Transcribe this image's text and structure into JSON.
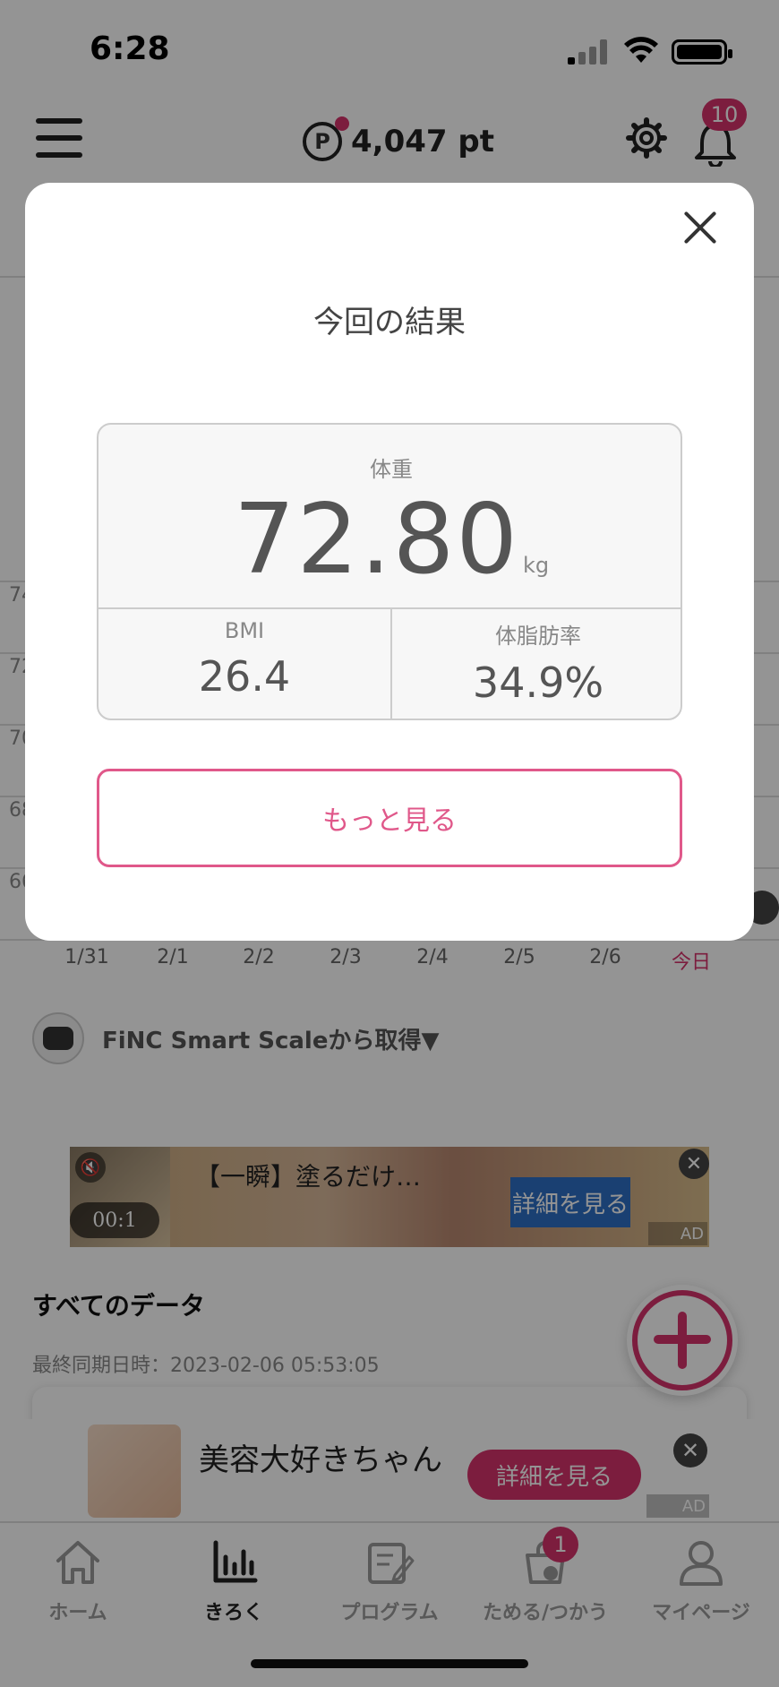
{
  "status_bar": {
    "time": "6:28"
  },
  "header": {
    "points": "4,047 pt",
    "points_icon": "P",
    "notification_count": "10"
  },
  "chart": {
    "y_labels": [
      "74",
      "72",
      "70",
      "68",
      "66"
    ],
    "x_labels": [
      "1/31",
      "2/1",
      "2/2",
      "2/3",
      "2/4",
      "2/5",
      "2/6",
      "今日"
    ]
  },
  "source": {
    "label": "FiNC Smart Scaleから取得▼"
  },
  "ad1": {
    "title": "【一瞬】塗るだけ…",
    "timer": "00:1",
    "button": "詳細を見る",
    "mute_icon": "🔇",
    "close": "✕",
    "tag": "AD"
  },
  "all_data": {
    "title": "すべてのデータ",
    "last_sync": "最終同期日時：2023-02-06 05:53:05"
  },
  "ad2": {
    "title": "美容大好きちゃん",
    "button": "詳細を見る",
    "close": "✕",
    "tag": "AD"
  },
  "tabbar": {
    "tabs": [
      {
        "label": "ホーム",
        "icon": "home-icon"
      },
      {
        "label": "きろく",
        "icon": "chart-icon"
      },
      {
        "label": "プログラム",
        "icon": "program-icon"
      },
      {
        "label": "ためる/つかう",
        "icon": "shopping-bag-icon"
      },
      {
        "label": "マイページ",
        "icon": "person-icon"
      }
    ],
    "badge": "1"
  },
  "modal": {
    "title": "今回の結果",
    "weight_label": "体重",
    "weight_value": "72.80",
    "weight_unit": "kg",
    "bmi_label": "BMI",
    "bmi_value": "26.4",
    "fat_label": "体脂肪率",
    "fat_value": "34.9%",
    "more_button": "もっと見る"
  },
  "colors": {
    "accent": "#d6336c",
    "accent_light": "#e0588a"
  }
}
